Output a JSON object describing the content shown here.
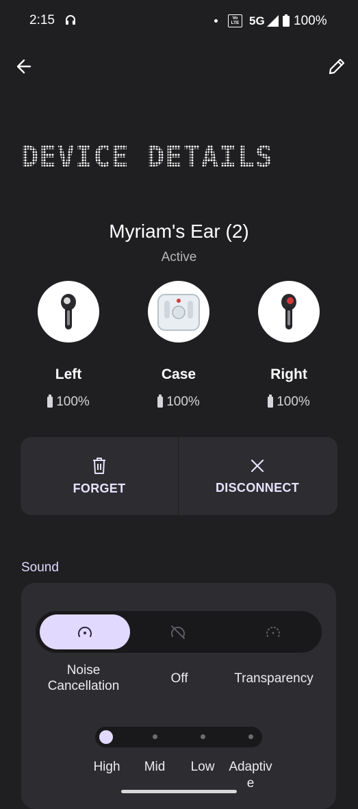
{
  "status_bar": {
    "time": "2:15",
    "volte": "Vo\nLTE",
    "network": "5G",
    "battery": "100%"
  },
  "header": {
    "back_icon": "arrow-left-icon",
    "edit_icon": "pencil-icon"
  },
  "page_title": "DEVICE DETAILS",
  "device": {
    "name": "Myriam's Ear (2)",
    "status": "Active",
    "components": [
      {
        "label": "Left",
        "battery": "100%"
      },
      {
        "label": "Case",
        "battery": "100%"
      },
      {
        "label": "Right",
        "battery": "100%"
      }
    ]
  },
  "actions": {
    "forget": "FORGET",
    "disconnect": "DISCONNECT"
  },
  "sound": {
    "section_label": "Sound",
    "modes": [
      "Noise\nCancellation",
      "Off",
      "Transparency"
    ],
    "selected_mode": "Noise Cancellation",
    "levels": [
      "High",
      "Mid",
      "Low",
      "Adaptiv\ne"
    ],
    "selected_level": "High"
  },
  "colors": {
    "background": "#1f1f21",
    "card": "#2d2d31",
    "accent": "#e2d9ff"
  }
}
